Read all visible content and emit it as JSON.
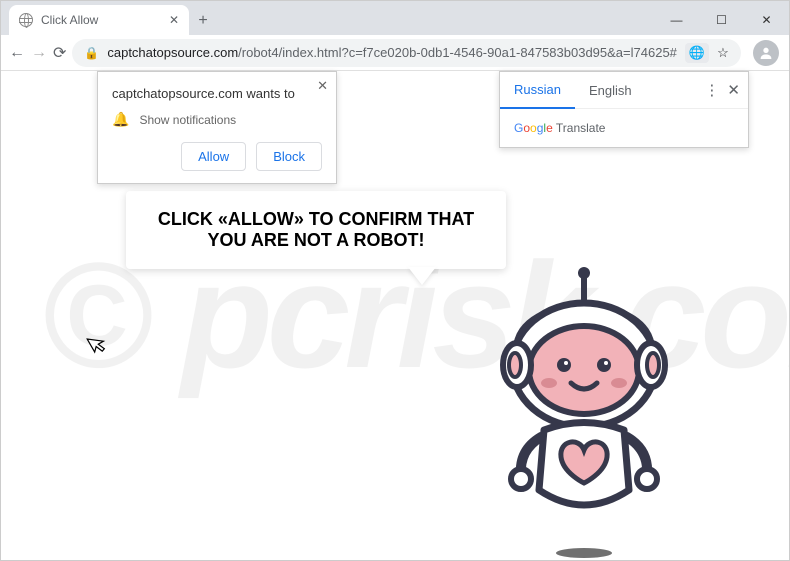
{
  "window": {
    "tab_title": "Click Allow",
    "minimize_glyph": "—",
    "maximize_glyph": "☐",
    "close_glyph": "✕"
  },
  "nav": {
    "back_glyph": "←",
    "forward_glyph": "→",
    "reload_glyph": "⟳"
  },
  "address": {
    "lock_glyph": "🔒",
    "host": "captchatopsource.com",
    "path": "/robot4/index.html?c=f7ce020b-0db1-4546-90a1-847583b03d95&a=l74625#",
    "translate_glyph": "🌐",
    "star_glyph": "☆",
    "menu_glyph": "⋮"
  },
  "notif": {
    "site_line": "captchatopsource.com wants to",
    "bell_glyph": "🔔",
    "perm_line": "Show notifications",
    "allow": "Allow",
    "block": "Block",
    "close_glyph": "✕"
  },
  "translate": {
    "tab_active": "Russian",
    "tab_other": "English",
    "options_glyph": "⋮",
    "close_glyph": "✕",
    "brand_tail": " Translate"
  },
  "page": {
    "bubble_text": "CLICK «ALLOW» TO CONFIRM THAT YOU ARE NOT A ROBOT!"
  },
  "watermark": "© pcrisk.com",
  "colors": {
    "robot_outline": "#36384b",
    "robot_pink": "#f2b2b8",
    "robot_dark_pink": "#d98b93",
    "robot_white": "#ffffff"
  },
  "cursor_glyph": "➤"
}
